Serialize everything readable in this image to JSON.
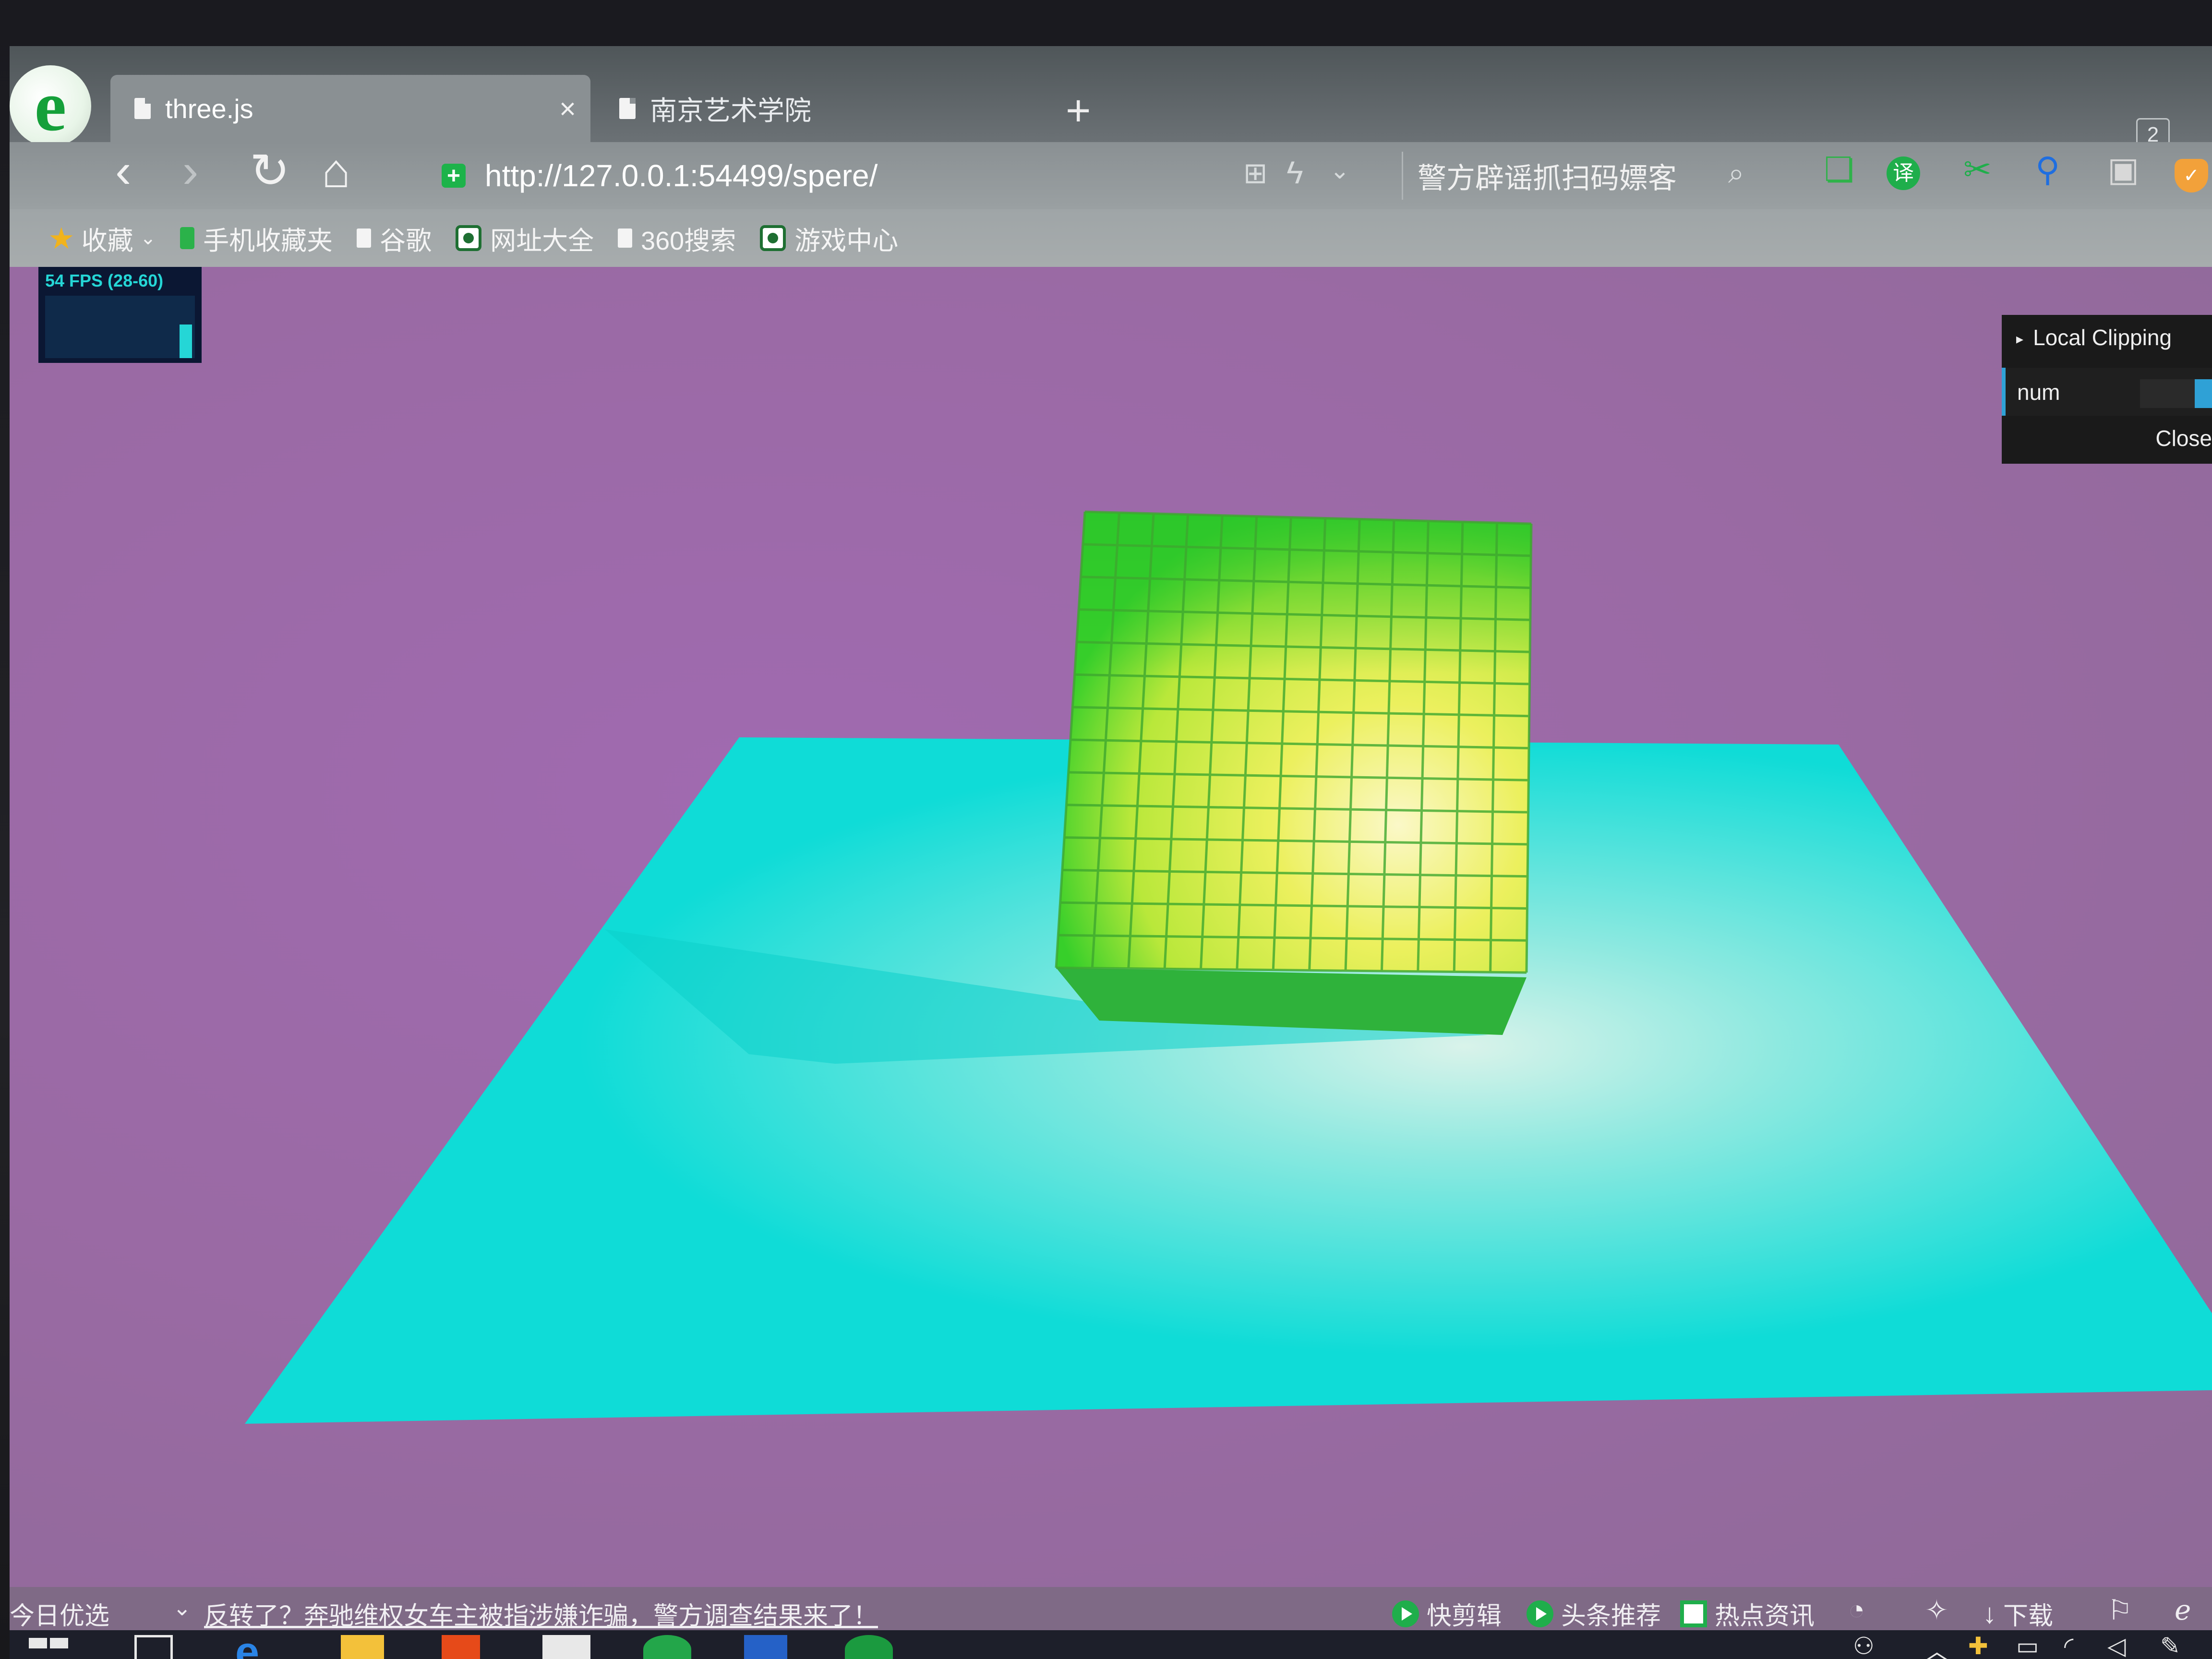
{
  "browser": {
    "tabs": [
      {
        "title": "three.js",
        "active": true
      },
      {
        "title": "南京艺术学院",
        "active": false
      }
    ],
    "tab_close": "×",
    "new_tab": "+",
    "tab_count": "2",
    "address": "http://127.0.0.1:54499/spere/",
    "search_hint": "警方辟谣抓扫码嫖客",
    "bookmarks": [
      "收藏",
      "手机收藏夹",
      "谷歌",
      "网址大全",
      "360搜索",
      "游戏中心"
    ],
    "translate_label": "译"
  },
  "stats": {
    "fps": "54 FPS (28-60)",
    "fps_value": 54,
    "fps_min": 28,
    "fps_max": 60
  },
  "gui": {
    "folder": "Local Clipping",
    "controls": [
      {
        "label": "num"
      }
    ],
    "close": "Close"
  },
  "scene": {
    "background_color": "#9b6aa8",
    "plane_color": "#10dcd8",
    "cube_top_color": "#2fd12f",
    "cube_center_color": "#e7f05a",
    "grid_columns": 13,
    "grid_rows": 14
  },
  "statusbar": {
    "today": "今日优选",
    "headline": "反转了？奔驰维权女车主被指涉嫌诈骗，警方调查结果来了！",
    "items": [
      "快剪辑",
      "头条推荐",
      "热点资讯"
    ],
    "download": "下载"
  },
  "icons": {
    "back": "back-arrow-icon",
    "forward": "forward-arrow-icon",
    "reload": "reload-icon",
    "home": "home-icon",
    "search": "search-icon"
  }
}
